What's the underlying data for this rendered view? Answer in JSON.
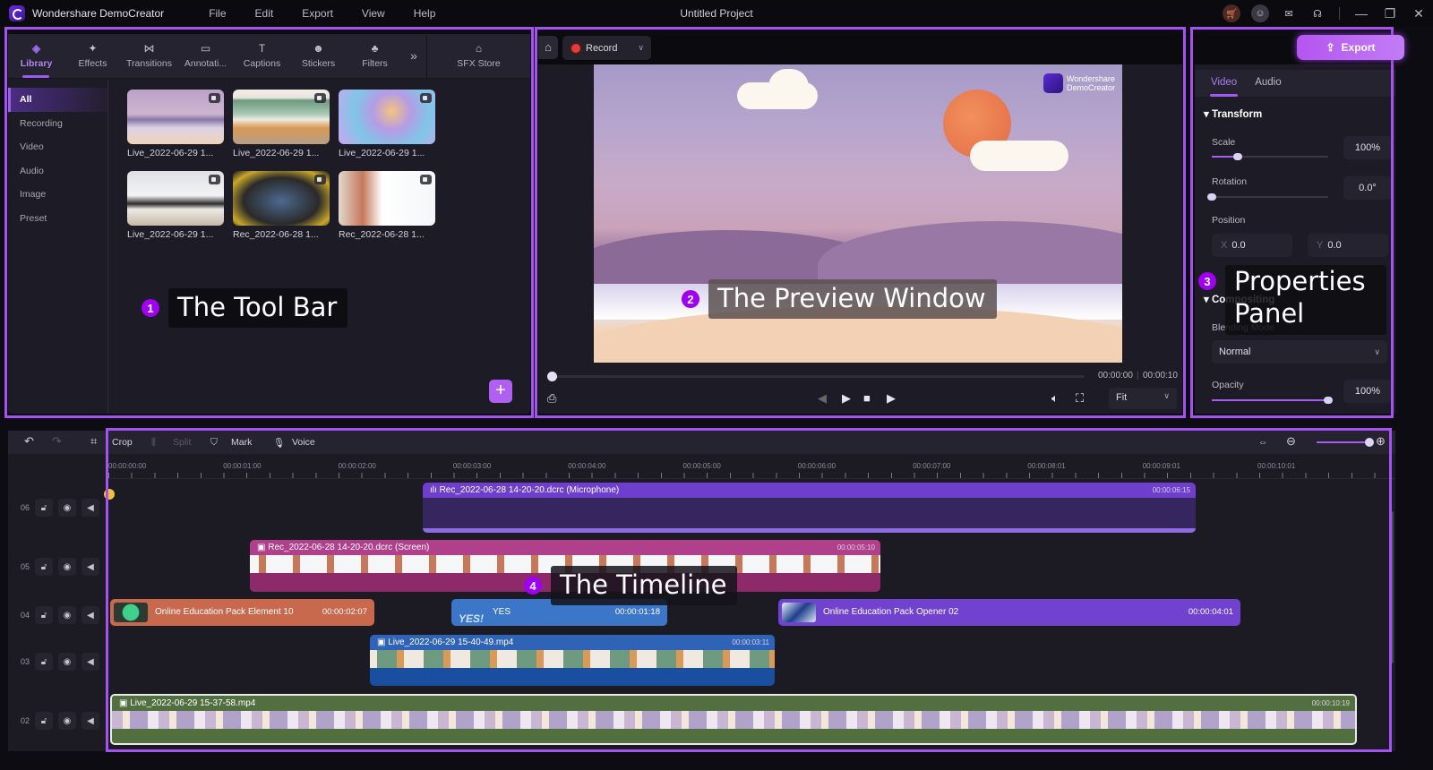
{
  "titlebar": {
    "app_name": "Wondershare DemoCreator",
    "menu": [
      "File",
      "Edit",
      "Export",
      "View",
      "Help"
    ],
    "project_title": "Untitled Project",
    "icons": [
      "cart-icon",
      "account-icon",
      "mail-icon",
      "support-icon"
    ],
    "window_controls": {
      "minimize": "—",
      "restore": "❐",
      "close": "✕"
    }
  },
  "toolbar": {
    "tabs": [
      {
        "label": "Library",
        "icon": "library-icon",
        "glyph": "◈",
        "active": true
      },
      {
        "label": "Effects",
        "icon": "effects-icon",
        "glyph": "✦"
      },
      {
        "label": "Transitions",
        "icon": "transitions-icon",
        "glyph": "⋈"
      },
      {
        "label": "Annotati...",
        "icon": "annotations-icon",
        "glyph": "▭"
      },
      {
        "label": "Captions",
        "icon": "captions-icon",
        "glyph": "T"
      },
      {
        "label": "Stickers",
        "icon": "stickers-icon",
        "glyph": "☻"
      },
      {
        "label": "Filters",
        "icon": "filters-icon",
        "glyph": "♣"
      }
    ],
    "more_glyph": "»",
    "sfx_store": {
      "label": "SFX Store",
      "glyph": "⌂"
    }
  },
  "library": {
    "categories": [
      "All",
      "Recording",
      "Video",
      "Audio",
      "Image",
      "Preset"
    ],
    "active_category": "All",
    "media": [
      {
        "name": "Live_2022-06-29 1..."
      },
      {
        "name": "Live_2022-06-29 1..."
      },
      {
        "name": "Live_2022-06-29 1..."
      },
      {
        "name": "Live_2022-06-29 1..."
      },
      {
        "name": "Rec_2022-06-28 1..."
      },
      {
        "name": "Rec_2022-06-28 1..."
      }
    ],
    "add_label": "+"
  },
  "callouts": [
    {
      "num": "1",
      "text": "The Tool Bar"
    },
    {
      "num": "2",
      "text": "The Preview Window"
    },
    {
      "num": "3",
      "text": "Properties Panel"
    },
    {
      "num": "4",
      "text": "The Timeline"
    }
  ],
  "preview": {
    "record_label": "Record",
    "watermark_line1": "Wondershare",
    "watermark_line2": "DemoCreator",
    "current_time": "00:00:00",
    "total_time": "00:00:10",
    "progress": 0,
    "fit_label": "Fit"
  },
  "properties": {
    "export_label": "Export",
    "tabs": [
      "Video",
      "Audio"
    ],
    "active_tab": "Video",
    "transform": {
      "title": "Transform",
      "scale_label": "Scale",
      "scale_value": "100%",
      "scale_fraction": 0.22,
      "rotation_label": "Rotation",
      "rotation_value": "0.0°",
      "rotation_fraction": 0.0,
      "position_label": "Position",
      "x_label": "X",
      "x_value": "0.0",
      "y_label": "Y",
      "y_value": "0.0"
    },
    "compositing": {
      "title": "Compositing",
      "blend_label": "Blending Mode",
      "blend_value": "Normal",
      "opacity_label": "Opacity",
      "opacity_value": "100%",
      "opacity_fraction": 1.0
    }
  },
  "timeline": {
    "tools": {
      "crop": "Crop",
      "split": "Split",
      "mark": "Mark",
      "voice": "Voice"
    },
    "ruler": [
      "00:00:00:00",
      "00:00:01:00",
      "00:00:02:00",
      "00:00:03:00",
      "00:00:04:00",
      "00:00:05:00",
      "00:00:06:00",
      "00:00:07:00",
      "00:00:08:01",
      "00:00:09:01",
      "00:00:10:01"
    ],
    "tracks": [
      "06",
      "05",
      "04",
      "03",
      "02"
    ],
    "clips": [
      {
        "name": "Rec_2022-06-28 14-20-20.dcrc (Microphone)",
        "duration": "00:00:06:15",
        "track": "06",
        "type": "audio",
        "color": "#6e3fcc"
      },
      {
        "name": "Rec_2022-06-28 14-20-20.dcrc (Screen)",
        "duration": "00:00:05:10",
        "track": "05",
        "type": "video",
        "color": "#b03f8c"
      },
      {
        "name": "Online Education Pack Element 10",
        "duration": "00:00:02:07",
        "track": "04",
        "type": "element",
        "color": "#c8694e"
      },
      {
        "name": "YES",
        "duration": "00:00:01:18",
        "track": "04",
        "type": "text",
        "color": "#3b76c8"
      },
      {
        "name": "Online Education Pack Opener 02",
        "duration": "00:00:04:01",
        "track": "04",
        "type": "element",
        "color": "#7042cf"
      },
      {
        "name": "Live_2022-06-29 15-40-49.mp4",
        "duration": "00:00:03:11",
        "track": "03",
        "type": "video",
        "color": "#2f63b8"
      },
      {
        "name": "Live_2022-06-29 15-37-58.mp4",
        "duration": "00:00:10:19",
        "track": "02",
        "type": "video",
        "color": "#52703f"
      }
    ]
  }
}
